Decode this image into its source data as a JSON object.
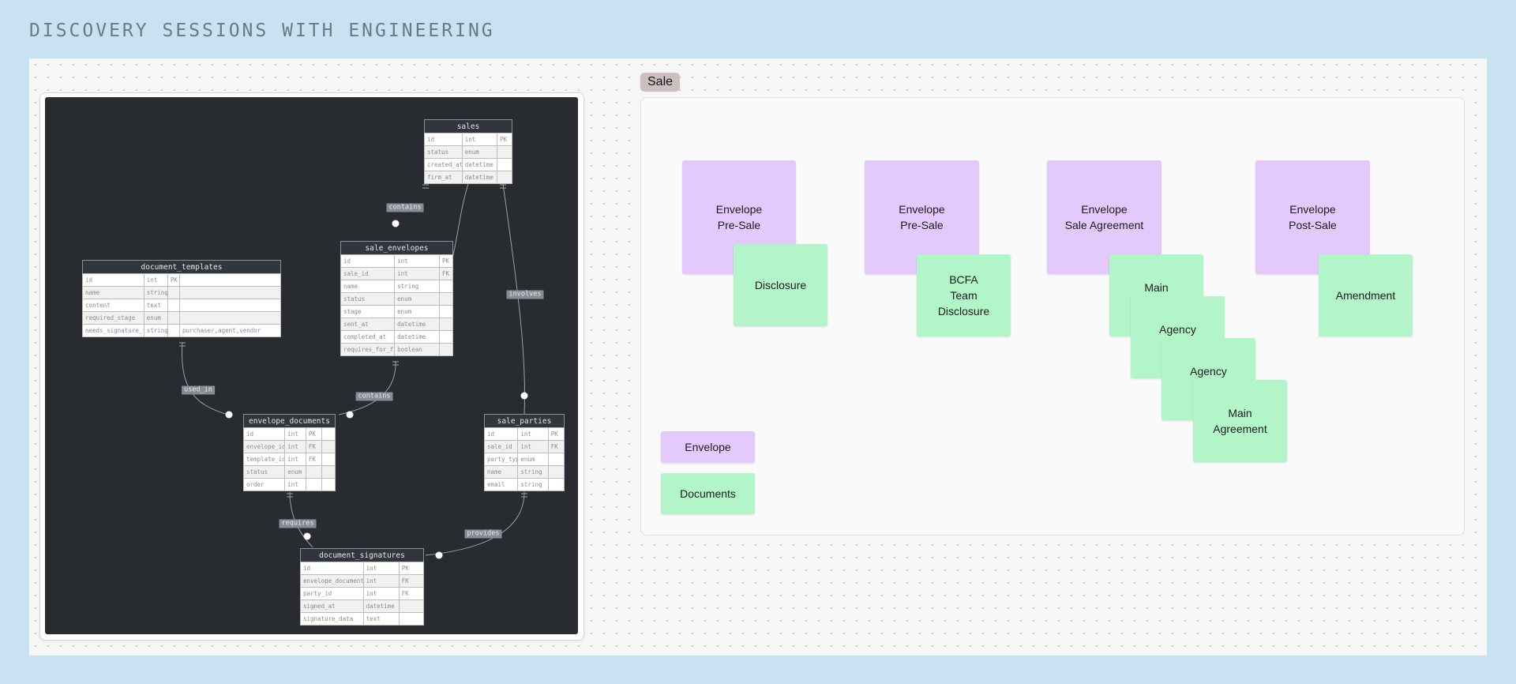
{
  "page_title": "DISCOVERY SESSIONS WITH ENGINEERING",
  "colors": {
    "envelope": "#e4cafc",
    "document": "#b2f5c9",
    "erd_background": "#282b30"
  },
  "erd": {
    "entities": {
      "sales": {
        "title": "sales",
        "rows": [
          [
            "id",
            "int",
            "PK"
          ],
          [
            "status",
            "enum",
            ""
          ],
          [
            "created_at",
            "datetime",
            ""
          ],
          [
            "firm_at",
            "datetime",
            ""
          ]
        ]
      },
      "sale_envelopes": {
        "title": "sale_envelopes",
        "rows": [
          [
            "id",
            "int",
            "PK"
          ],
          [
            "sale_id",
            "int",
            "FK"
          ],
          [
            "name",
            "string",
            ""
          ],
          [
            "status",
            "enum",
            ""
          ],
          [
            "stage",
            "enum",
            ""
          ],
          [
            "sent_at",
            "datetime",
            ""
          ],
          [
            "completed_at",
            "datetime",
            ""
          ],
          [
            "requires_for_firm",
            "boolean",
            ""
          ]
        ]
      },
      "document_templates": {
        "title": "document_templates",
        "rows": [
          [
            "id",
            "int",
            "PK",
            ""
          ],
          [
            "name",
            "string",
            "",
            ""
          ],
          [
            "content",
            "text",
            "",
            ""
          ],
          [
            "required_stage",
            "enum",
            "",
            ""
          ],
          [
            "needs_signature_from",
            "string",
            "",
            "purchaser,agent,vendor"
          ]
        ]
      },
      "envelope_documents": {
        "title": "envelope_documents",
        "rows": [
          [
            "id",
            "int",
            "PK",
            ""
          ],
          [
            "envelope_id",
            "int",
            "FK",
            ""
          ],
          [
            "template_id",
            "int",
            "FK",
            ""
          ],
          [
            "status",
            "enum",
            "",
            ""
          ],
          [
            "order",
            "int",
            "",
            ""
          ]
        ]
      },
      "sale_parties": {
        "title": "sale_parties",
        "rows": [
          [
            "id",
            "int",
            "PK"
          ],
          [
            "sale_id",
            "int",
            "FK"
          ],
          [
            "party_type",
            "enum",
            ""
          ],
          [
            "name",
            "string",
            ""
          ],
          [
            "email",
            "string",
            ""
          ]
        ]
      },
      "document_signatures": {
        "title": "document_signatures",
        "rows": [
          [
            "id",
            "int",
            "PK"
          ],
          [
            "envelope_document_id",
            "int",
            "FK"
          ],
          [
            "party_id",
            "int",
            "FK"
          ],
          [
            "signed_at",
            "datetime",
            ""
          ],
          [
            "signature_data",
            "text",
            ""
          ]
        ]
      }
    },
    "relations": {
      "contains_1": "contains",
      "involves": "involves",
      "used_in": "used_in",
      "contains_2": "contains",
      "requires": "requires",
      "provides": "provides"
    }
  },
  "sale_board": {
    "tag": "Sale",
    "envelopes": [
      "Envelope\nPre-Sale",
      "Envelope\nPre-Sale",
      "Envelope\nSale Agreement",
      "Envelope\nPost-Sale"
    ],
    "documents": [
      "Disclosure",
      "BCFA\nTeam\nDisclosure",
      "Main\n.",
      "Agency\nDi",
      "Agency\nDi",
      "Main\nAgreement",
      "Amendment"
    ],
    "legend": {
      "envelope": "Envelope",
      "documents": "Documents"
    }
  }
}
